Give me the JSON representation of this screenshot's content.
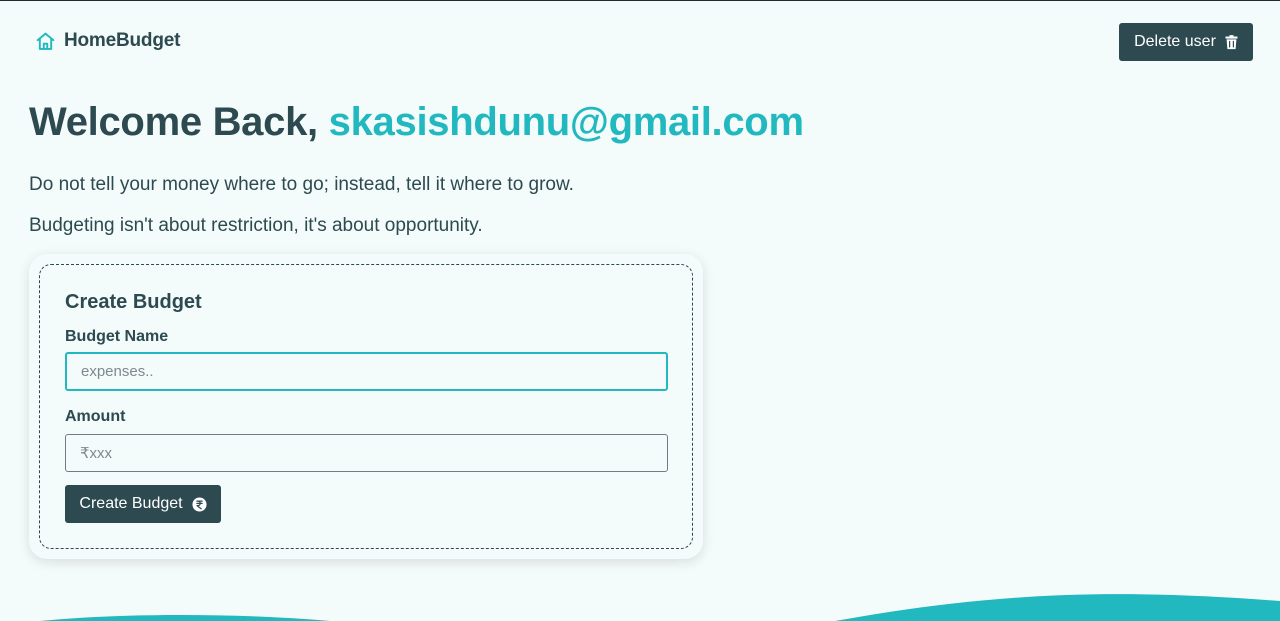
{
  "nav": {
    "brand_icon": "house-icon",
    "brand_name": "HomeBudget",
    "delete_label": "Delete user",
    "delete_icon": "trash-icon"
  },
  "hero": {
    "welcome_prefix": "Welcome Back, ",
    "user_email": "skasishdunu@gmail.com",
    "quote_1": "Do not tell your money where to go; instead, tell it where to grow.",
    "quote_2": "Budgeting isn't about restriction, it's about opportunity."
  },
  "create_budget": {
    "title": "Create Budget",
    "name_label": "Budget Name",
    "name_placeholder": "expenses..",
    "name_value": "",
    "amount_label": "Amount",
    "amount_placeholder": "₹xxx",
    "amount_value": "",
    "submit_label": "Create Budget",
    "submit_icon": "rupee-circle-icon"
  },
  "colors": {
    "primary": "#2c4a50",
    "accent": "#21b8bf",
    "background": "#f4fbfb"
  }
}
